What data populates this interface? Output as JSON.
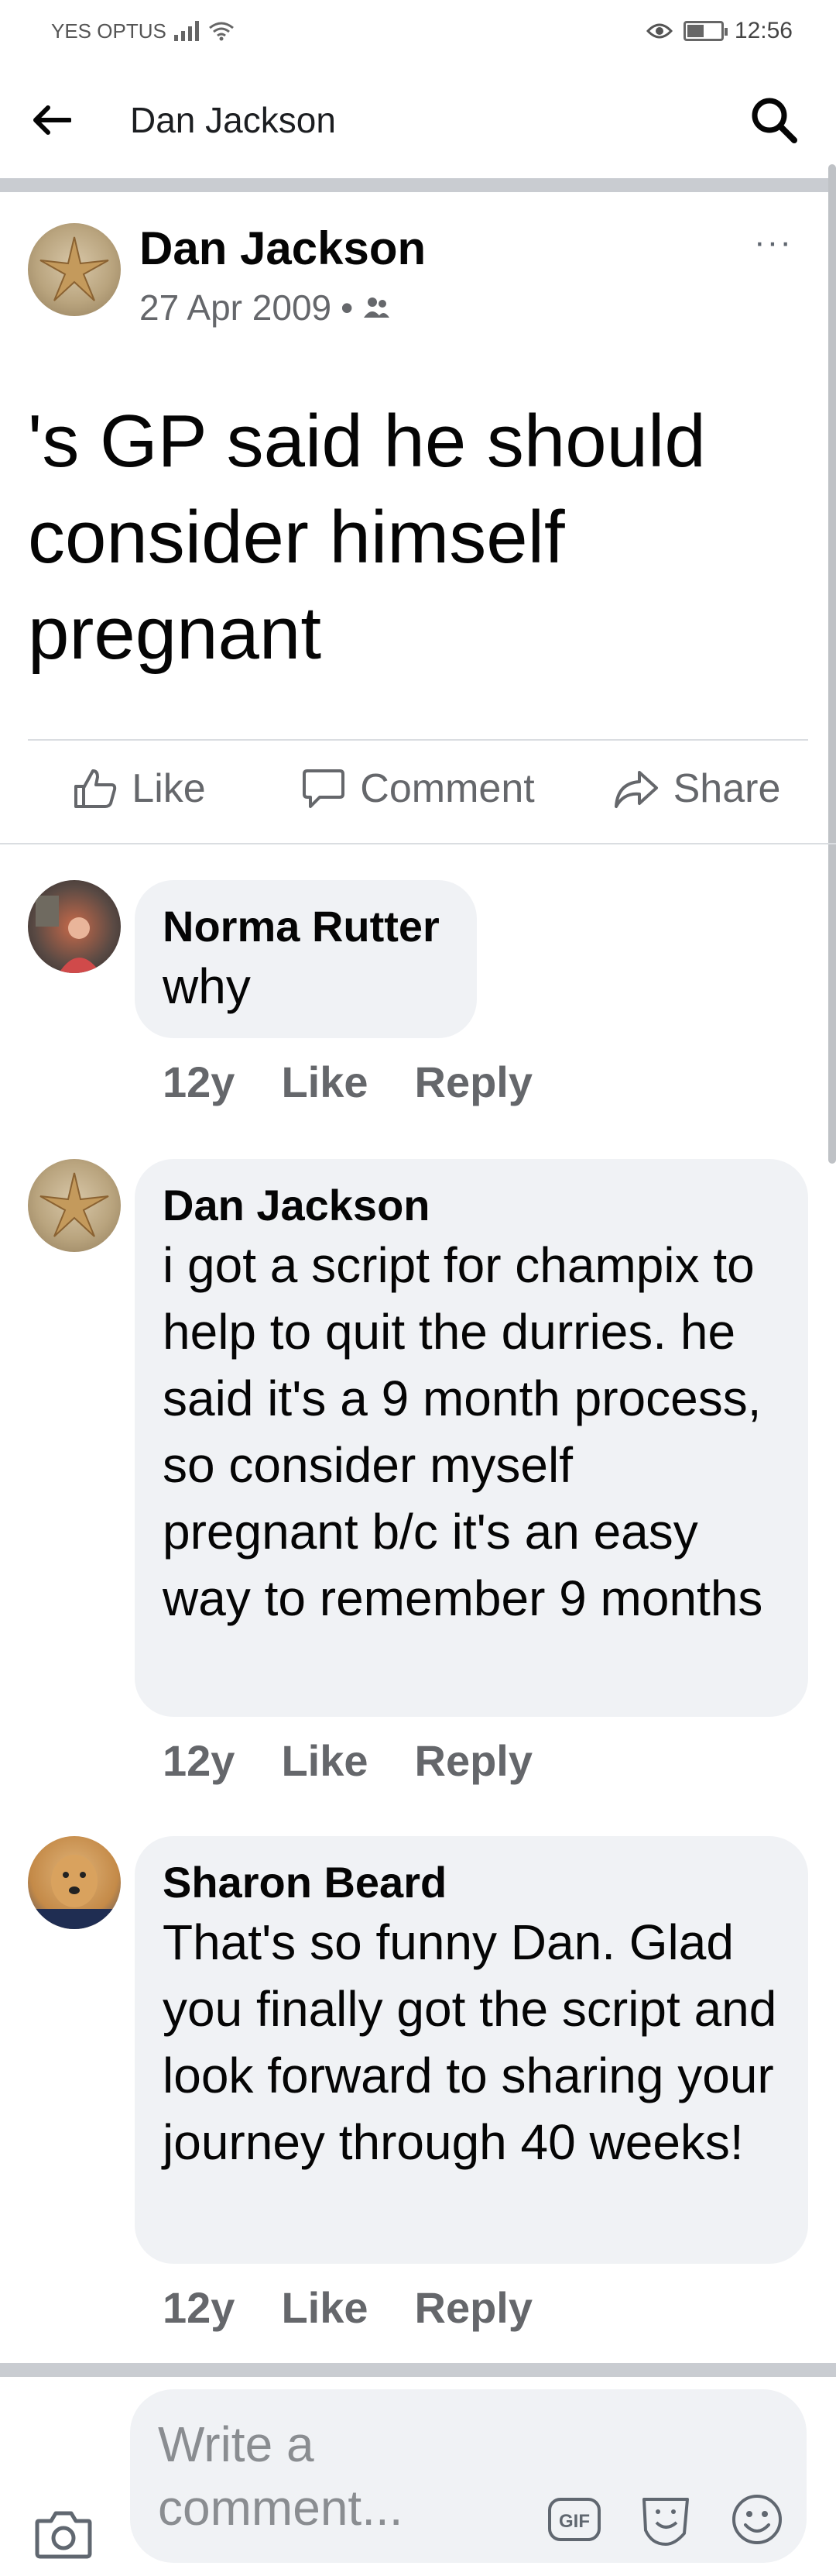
{
  "status_bar": {
    "carrier": "YES OPTUS",
    "time": "12:56",
    "battery_level": 0.45
  },
  "header": {
    "title": "Dan Jackson",
    "back_icon": "back-arrow-icon",
    "search_icon": "search-icon"
  },
  "post": {
    "author": "Dan Jackson",
    "date": "27 Apr 2009",
    "separator": "•",
    "audience_icon": "friends-icon",
    "more_label": "···",
    "text": "'s GP said he should consider himself pregnant",
    "actions": {
      "like": "Like",
      "comment": "Comment",
      "share": "Share"
    }
  },
  "comments": [
    {
      "author": "Norma Rutter",
      "text": "why",
      "time": "12y",
      "like": "Like",
      "reply": "Reply"
    },
    {
      "author": "Dan Jackson",
      "text": "i got a script for champix to help to quit the durries. he said it's a 9 month process, so consider myself pregnant b/c it's an easy way to remember 9 months",
      "time": "12y",
      "like": "Like",
      "reply": "Reply"
    },
    {
      "author": "Sharon Beard",
      "text": "That's so funny Dan. Glad you finally got the script and look forward to sharing your journey through 40 weeks!",
      "time": "12y",
      "like": "Like",
      "reply": "Reply"
    }
  ],
  "composer": {
    "placeholder": "Write a comment...",
    "camera_icon": "camera-icon",
    "gif_label": "GIF",
    "sticker_icon": "sticker-icon",
    "emoji_icon": "emoji-icon"
  },
  "colors": {
    "secondary_text": "#65676b",
    "bubble": "#f0f2f5",
    "divider": "#c9ccd1"
  }
}
